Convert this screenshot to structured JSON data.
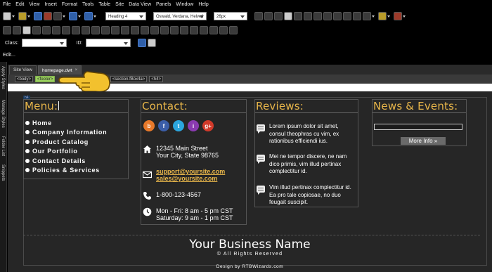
{
  "menubar": {
    "items": [
      "File",
      "Edit",
      "View",
      "Insert",
      "Format",
      "Tools",
      "Table",
      "Site",
      "Data View",
      "Panels",
      "Window",
      "Help"
    ]
  },
  "toolbar": {
    "heading_select": "Heading 4",
    "font_select": "Oswald, Verdana, Helveti",
    "size_select": "26px",
    "class_label": "Class:",
    "id_label": "ID:",
    "edit_label": "Edit..."
  },
  "side_tabs": [
    "Apply Styles",
    "Manage Styles",
    "Folder List",
    "Snippets"
  ],
  "document": {
    "tab_label": "Site View",
    "file_tab": "homepage.dwt",
    "close_glyph": "×"
  },
  "tag_selector": [
    "<body>",
    "<footer>",
    "<section.fBox4a>",
    "<h4>"
  ],
  "tag_fragment": ">",
  "canvas": {
    "box_label": "h4",
    "menu": {
      "title": "Menu:",
      "items": [
        "Home",
        "Company Information",
        "Product Catalog",
        "Our Portfolio",
        "Contact Details",
        "Policies & Services"
      ]
    },
    "contact": {
      "title": "Contact:",
      "social": [
        "b",
        "f",
        "t",
        "i",
        "g+"
      ],
      "address_line1": "12345 Main Street",
      "address_line2": "Your City, State 98765",
      "email1": "support@yoursite.com",
      "email2": "sales@yoursite.com",
      "phone": "1-800-123-4567",
      "hours_line1": "Mon - Fri: 8 am - 5 pm CST",
      "hours_line2": "Saturday: 9 am - 1 pm CST"
    },
    "reviews": {
      "title": "Reviews:",
      "items": [
        "Lorem ipsum dolor sit amet, consul theophras cu vim, ex rationibus efficiendi ius.",
        "Mei ne tempor discere, ne nam dico primis, vim illud pertinax complectitur id.",
        "Vim illud pertinax complectitur id. Ea pro tale copiosae, no duo feugait suscipit."
      ]
    },
    "news": {
      "title": "News & Events:",
      "button": "More Info »"
    },
    "footer": {
      "business": "Your Business Name",
      "rights": "© All Rights Reserved",
      "design": "Design by RTBWizards.com"
    }
  },
  "colors": {
    "accent": "#e8b64a",
    "background": "#262626",
    "tag_highlight": "#9bd060"
  }
}
